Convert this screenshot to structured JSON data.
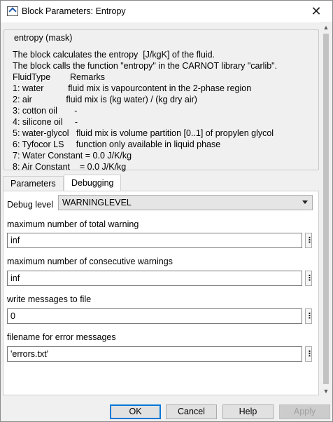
{
  "window": {
    "title": "Block Parameters: Entropy",
    "close_glyph": "✕"
  },
  "mask": {
    "legend": "entropy (mask)",
    "description_lines": [
      "The block calculates the entropy  [J/kgK] of the fluid.",
      "The block calls the function \"entropy\" in the CARNOT library \"carlib\".",
      "FluidType        Remarks",
      "1: water          fluid mix is vapourcontent in the 2-phase region",
      "2: air              fluid mix is (kg water) / (kg dry air)",
      "3: cotton oil       -",
      "4: silicone oil     -",
      "5: water-glycol   fluid mix is volume partition [0..1] of propylen glycol",
      "6: Tyfocor LS     function only available in liquid phase",
      "7: Water Constant = 0.0 J/K/kg",
      "8: Air Constant    = 0.0 J/K/kg"
    ]
  },
  "tabs": [
    {
      "label": "Parameters",
      "active": false
    },
    {
      "label": "Debugging",
      "active": true
    }
  ],
  "debugging": {
    "debug_level_label": "Debug level",
    "debug_level_value": "WARNINGLEVEL",
    "params": [
      {
        "label": "maximum number of total warning",
        "value": "inf"
      },
      {
        "label": "maximum number of consecutive warnings",
        "value": "inf"
      },
      {
        "label": "write messages to file",
        "value": "0"
      },
      {
        "label": "filename for error messages",
        "value": "'errors.txt'"
      }
    ],
    "param_menu_glyph": "⋮"
  },
  "buttons": {
    "ok": "OK",
    "cancel": "Cancel",
    "help": "Help",
    "apply": "Apply",
    "apply_enabled": false
  },
  "scrollbar": {
    "up_glyph": "▲",
    "down_glyph": "▼"
  },
  "colors": {
    "focus_blue": "#0078d7",
    "disabled_text": "#a0a0a0"
  }
}
